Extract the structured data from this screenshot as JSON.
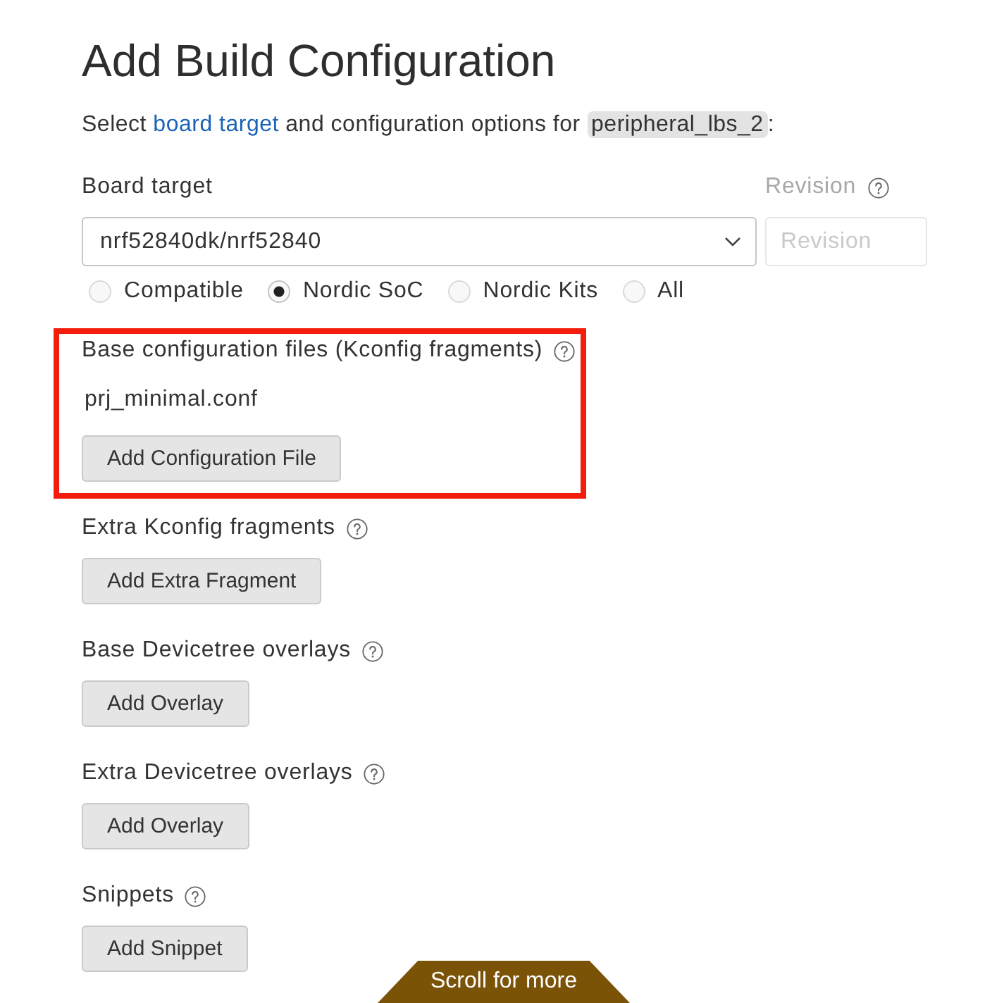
{
  "title": "Add Build Configuration",
  "intro": [
    {
      "kind": "text",
      "text": "Select "
    },
    {
      "kind": "link",
      "text": "board target"
    },
    {
      "kind": "text",
      "text": " and configuration options for "
    },
    {
      "kind": "code",
      "text": "peripheral_lbs_2"
    },
    {
      "kind": "text",
      "text": ":"
    }
  ],
  "board_target": {
    "label": "Board target",
    "value": "nrf52840dk/nrf52840"
  },
  "revision": {
    "label": "Revision",
    "placeholder": "Revision",
    "disabled": true
  },
  "filters": [
    {
      "label": "Compatible",
      "selected": false
    },
    {
      "label": "Nordic SoC",
      "selected": true
    },
    {
      "label": "Nordic Kits",
      "selected": false
    },
    {
      "label": "All",
      "selected": false
    }
  ],
  "sections": [
    {
      "title": "Base configuration files (Kconfig fragments)",
      "highlighted": true,
      "files": [
        "prj_minimal.conf"
      ],
      "button": "Add Configuration File"
    },
    {
      "title": "Extra Kconfig fragments",
      "highlighted": false,
      "button": "Add Extra Fragment"
    },
    {
      "title": "Base Devicetree overlays",
      "highlighted": false,
      "button": "Add Overlay"
    },
    {
      "title": "Extra Devicetree overlays",
      "highlighted": false,
      "button": "Add Overlay"
    },
    {
      "title": "Snippets",
      "highlighted": false,
      "button": "Add Snippet"
    }
  ],
  "scroll_hint": "Scroll for more"
}
